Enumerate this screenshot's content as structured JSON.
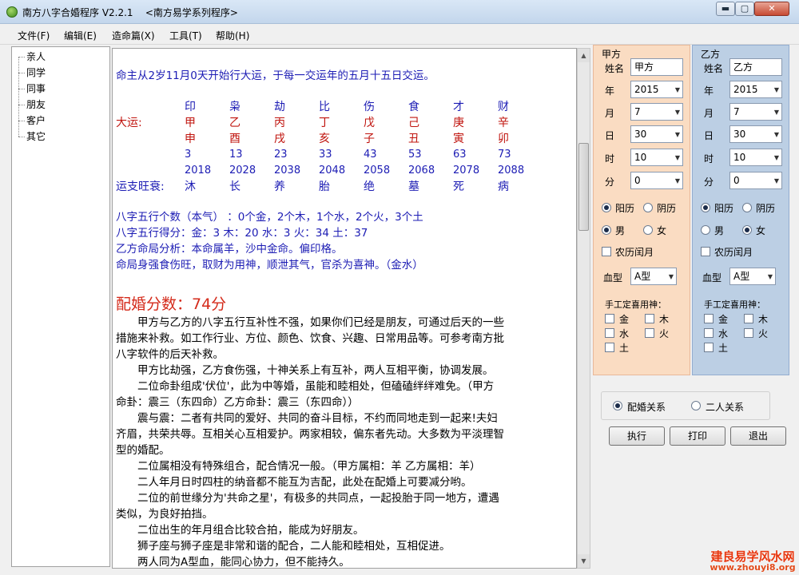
{
  "window": {
    "title": "南方八字合婚程序 V2.2.1    <南方易学系列程序>",
    "min": "▬",
    "max": "▢",
    "close": "✕"
  },
  "menu": [
    "文件(F)",
    "编辑(E)",
    "造命篇(X)",
    "工具(T)",
    "帮助(H)"
  ],
  "tree": [
    "亲人",
    "同学",
    "同事",
    "朋友",
    "客户",
    "其它"
  ],
  "report": {
    "intro": "命主从2岁11月0天开始行大运，于每一交运年的五月十五日交运。",
    "shishen": [
      "印",
      "枭",
      "劫",
      "比",
      "伤",
      "食",
      "才",
      "财"
    ],
    "dayun_label": "大运:",
    "gan": [
      "甲",
      "乙",
      "丙",
      "丁",
      "戊",
      "己",
      "庚",
      "辛"
    ],
    "zhi": [
      "申",
      "酉",
      "戌",
      "亥",
      "子",
      "丑",
      "寅",
      "卯"
    ],
    "ages": [
      "3",
      "13",
      "23",
      "33",
      "43",
      "53",
      "63",
      "73"
    ],
    "years": [
      "2018",
      "2028",
      "2038",
      "2048",
      "2058",
      "2068",
      "2078",
      "2088"
    ],
    "wangshuai_label": "运支旺衰:",
    "wangshuai": [
      "沐",
      "长",
      "养",
      "胎",
      "绝",
      "墓",
      "死",
      "病"
    ],
    "wuxing_count": "八字五行个数（本气）  ：0个金，2个木，1个水，2个火，3个土",
    "wuxing_score": "八字五行得分：金：3  木：20  水：3  火：34  土：37",
    "mingju": "乙方命局分析：本命属羊，沙中金命。偏印格。",
    "yongshen": "命局身强食伤旺，取财为用神，顺泄其气，官杀为喜神。（金水）",
    "score": "配婚分数：74分",
    "paragraphs": [
      "　　甲方与乙方的八字五行互补性不强，如果你们已经是朋友，可通过后天的一些",
      "措施来补救。如工作行业、方位、颜色、饮食、兴趣、日常用品等。可参考南方批",
      "八字软件的后天补救。",
      "　　甲方比劫强，乙方食伤强，十神关系上有互补，两人互相平衡，协调发展。",
      "　　二位命卦组成'伏位'，此为中等婚，虽能和睦相处，但磕磕绊绊难免。（甲方",
      "命卦：震三（东四命）乙方命卦：震三（东四命））",
      "　　震与震：二者有共同的爱好、共同的奋斗目标，不约而同地走到一起来!夫妇",
      "齐眉，共荣共辱。互相关心互相爱护。两家相较，偏东者先动。大多数为平淡理智",
      "型的婚配。",
      "　　二位属相没有特殊组合，配合情况一般。（甲方属相：羊 乙方属相：羊）",
      "　　二人年月日时四柱的纳音都不能互为吉配，此处在配婚上可要减分哟。",
      "　　二位的前世缘分为'共命之星'，有极多的共同点，一起投胎于同一地方，遭遇",
      "类似，为良好拍挡。",
      "　　二位出生的年月组合比较合拍，能成为好朋友。",
      "　　狮子座与狮子座是非常和谐的配合，二人能和睦相处，互相促进。",
      "　　两人同为A型血，能同心协力，但不能持久。"
    ]
  },
  "jia": {
    "title": "甲方",
    "name_label": "姓名",
    "name": "甲方",
    "year_label": "年",
    "year": "2015",
    "month_label": "月",
    "month": "7",
    "day_label": "日",
    "day": "30",
    "hour_label": "时",
    "hour": "10",
    "minute_label": "分",
    "minute": "0",
    "solar": "阳历",
    "lunar": "阴历",
    "male": "男",
    "female": "女",
    "leap": "农历闰月",
    "blood_label": "血型",
    "blood": "A型",
    "manual_label": "手工定喜用神：",
    "elements": [
      "金",
      "木",
      "水",
      "火",
      "土"
    ]
  },
  "yi": {
    "title": "乙方",
    "name_label": "姓名",
    "name": "乙方",
    "year_label": "年",
    "year": "2015",
    "month_label": "月",
    "month": "7",
    "day_label": "日",
    "day": "30",
    "hour_label": "时",
    "hour": "10",
    "minute_label": "分",
    "minute": "0",
    "solar": "阳历",
    "lunar": "阴历",
    "male": "男",
    "female": "女",
    "leap": "农历闰月",
    "blood_label": "血型",
    "blood": "A型",
    "manual_label": "手工定喜用神：",
    "elements": [
      "金",
      "木",
      "水",
      "火",
      "土"
    ]
  },
  "relation": {
    "marriage": "配婚关系",
    "two_person": "二人关系"
  },
  "buttons": {
    "execute": "执行",
    "print": "打印",
    "exit": "退出"
  },
  "watermark": {
    "name": "建良易学风水网",
    "url": "www.zhouyi8.org"
  },
  "colors": {
    "report_blue": "#1c1cb4",
    "report_red": "#c0140e",
    "score_red": "#d42a1a",
    "jia_bg": "#fadcc2",
    "yi_bg": "#bccfe4"
  }
}
